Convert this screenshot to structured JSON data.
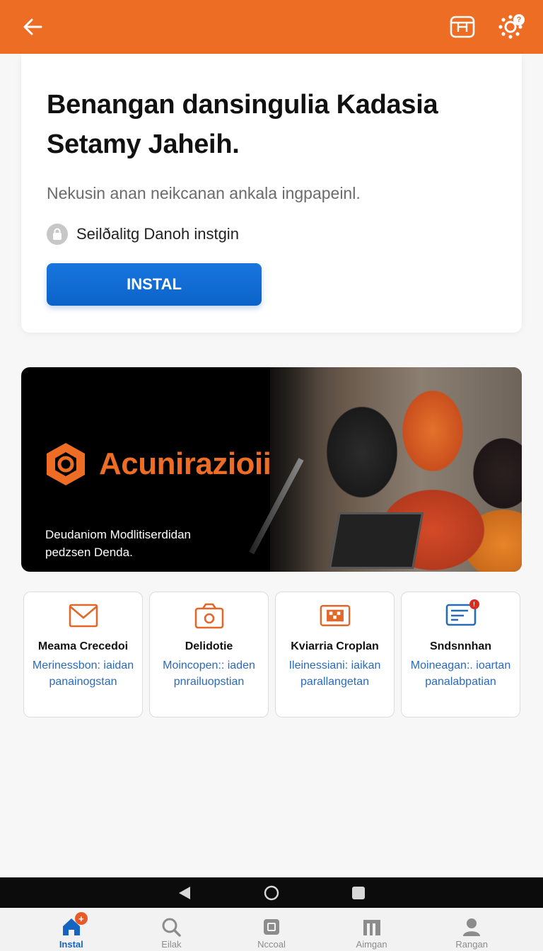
{
  "header": {
    "back_icon": "arrow-left-icon",
    "store_icon": "store-icon",
    "settings_icon": "gear-icon",
    "settings_badge": "?",
    "bg_color": "#ee6d24"
  },
  "install_card": {
    "title": "Benangan dansingulia Kadasia Setamy Jaheih.",
    "subtitle": "Nekusin anan neikcanan ankala ingpapeinl.",
    "security_text": "Seilðalitg Danoh instgin",
    "install_button": "INSTAL",
    "button_color": "#0b63c9"
  },
  "banner": {
    "brand_name": "Acunirazioii",
    "caption_line1": "Deudaniom Modlitiserdidan",
    "caption_line2": "pedzsen Denda.",
    "brand_color": "#ee6d24"
  },
  "features": [
    {
      "icon": "envelope-icon",
      "name": "Meama Crecedoi",
      "desc": "Merinessbon: iaidan panainogstan"
    },
    {
      "icon": "camera-icon",
      "name": "Delidotie",
      "desc": "Moincopen:: iaden pnrailuopstian"
    },
    {
      "icon": "qr-card-icon",
      "name": "Kviarria Croplan",
      "desc": "Ileinessiani: iaikan parallangetan"
    },
    {
      "icon": "monitor-card-icon",
      "name": "Sndsnnhan",
      "desc": "Moineagan:. ioartan panalabpatian",
      "badge": "!"
    }
  ],
  "tabs": [
    {
      "icon": "home-icon",
      "label": "Instal",
      "badge": "+",
      "active": true
    },
    {
      "icon": "search-icon",
      "label": "Eilak"
    },
    {
      "icon": "chip-icon",
      "label": "Nccoal"
    },
    {
      "icon": "building-icon",
      "label": "Aimgan"
    },
    {
      "icon": "person-icon",
      "label": "Rangan"
    }
  ]
}
